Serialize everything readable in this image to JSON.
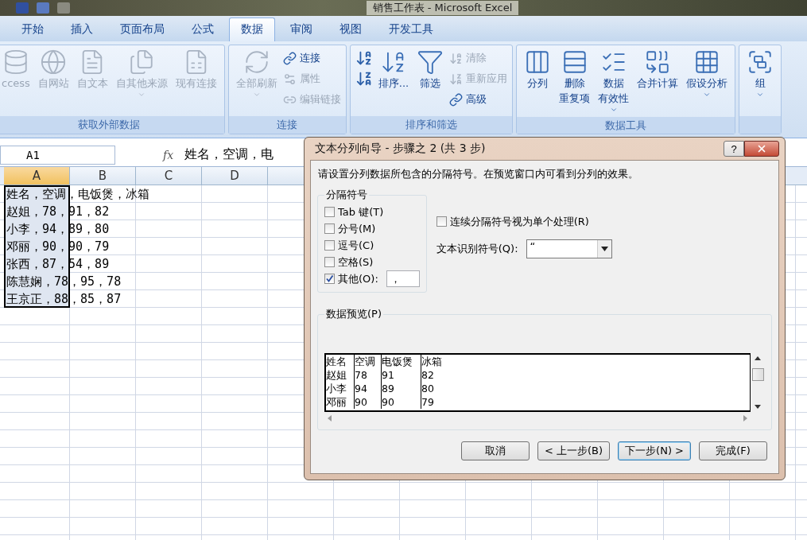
{
  "window": {
    "title": "销售工作表 - Microsoft Excel"
  },
  "ribbon_tabs": [
    {
      "label": "开始",
      "selected": false
    },
    {
      "label": "插入",
      "selected": false
    },
    {
      "label": "页面布局",
      "selected": false
    },
    {
      "label": "公式",
      "selected": false
    },
    {
      "label": "数据",
      "selected": true
    },
    {
      "label": "审阅",
      "selected": false
    },
    {
      "label": "视图",
      "selected": false
    },
    {
      "label": "开发工具",
      "selected": false
    }
  ],
  "ribbon_groups": [
    {
      "label": "获取外部数据",
      "items": [
        {
          "kind": "large",
          "label": "ccess",
          "disabled": true,
          "menu": false
        },
        {
          "kind": "large",
          "label": "自网站",
          "disabled": true,
          "menu": false
        },
        {
          "kind": "large",
          "label": "自文本",
          "disabled": true,
          "menu": false
        },
        {
          "kind": "large",
          "label": "自其他来源",
          "disabled": true,
          "menu": true
        },
        {
          "kind": "large",
          "label": "现有连接",
          "disabled": true,
          "menu": false
        }
      ]
    },
    {
      "label": "连接",
      "items": [
        {
          "kind": "large",
          "label": "全部刷新",
          "disabled": true,
          "menu": true
        },
        {
          "kind": "stack",
          "items": [
            {
              "label": "连接",
              "disabled": false
            },
            {
              "label": "属性",
              "disabled": true
            },
            {
              "label": "编辑链接",
              "disabled": true
            }
          ]
        }
      ]
    },
    {
      "label": "排序和筛选",
      "items": [
        {
          "kind": "stack",
          "items": [
            {
              "disabled": false
            },
            {
              "disabled": false
            }
          ]
        },
        {
          "kind": "large",
          "label": "排序...",
          "disabled": false,
          "menu": false
        },
        {
          "kind": "large",
          "label": "筛选",
          "disabled": false,
          "menu": false
        },
        {
          "kind": "stack",
          "items": [
            {
              "label": "清除",
              "disabled": true
            },
            {
              "label": "重新应用",
              "disabled": true
            },
            {
              "label": "高级",
              "disabled": false
            }
          ]
        }
      ]
    },
    {
      "label": "数据工具",
      "items": [
        {
          "kind": "large",
          "label": "分列",
          "disabled": false,
          "menu": false
        },
        {
          "kind": "large",
          "lines": [
            "删除",
            "重复项"
          ],
          "disabled": false,
          "menu": false
        },
        {
          "kind": "large",
          "lines": [
            "数据",
            "有效性"
          ],
          "disabled": false,
          "menu": true
        },
        {
          "kind": "large",
          "label": "合并计算",
          "disabled": false,
          "menu": false
        },
        {
          "kind": "large",
          "label": "假设分析",
          "disabled": false,
          "menu": true
        }
      ]
    },
    {
      "items": [
        {
          "kind": "large",
          "label": "组",
          "disabled": false,
          "menu": true
        }
      ]
    }
  ],
  "formula_bar": {
    "name_box": "A1",
    "fx": "fx",
    "formula": "姓名，空调，电"
  },
  "columns": [
    {
      "label": "A",
      "selected": true
    },
    {
      "label": "B",
      "selected": false
    },
    {
      "label": "C",
      "selected": false
    },
    {
      "label": "D",
      "selected": false
    }
  ],
  "rows": [
    {
      "text": "姓名，空调，电饭煲，冰箱",
      "selected": true
    },
    {
      "text": "赵姐，78，91，82",
      "selected": true
    },
    {
      "text": "小李，94，89，80",
      "selected": true
    },
    {
      "text": "邓丽，90，90，79",
      "selected": true
    },
    {
      "text": "张西，87，54，89",
      "selected": true
    },
    {
      "text": "陈慧娴，78，95，78",
      "selected": true
    },
    {
      "text": "王京正，88，85，87",
      "selected": true
    }
  ],
  "dialog": {
    "title": "文本分列向导 - 步骤之 2 (共 3 步)",
    "help": "?",
    "instruction": "请设置分列数据所包含的分隔符号。在预览窗口内可看到分列的效果。",
    "delimiters": {
      "label": "分隔符号",
      "options": [
        {
          "label": "Tab 键(T)",
          "checked": false
        },
        {
          "label": "分号(M)",
          "checked": false
        },
        {
          "label": "逗号(C)",
          "checked": false
        },
        {
          "label": "空格(S)",
          "checked": false
        },
        {
          "label": "其他(O):",
          "checked": true,
          "value": "，"
        }
      ]
    },
    "consecutive": {
      "label": "连续分隔符号视为单个处理(R)",
      "checked": false
    },
    "qualifier": {
      "label": "文本识别符号(Q):",
      "value": "“"
    },
    "preview": {
      "label": "数据预览(P)",
      "rows": [
        [
          "姓名",
          "空调",
          "电饭煲",
          "冰箱"
        ],
        [
          "赵姐",
          "78",
          "91",
          "82"
        ],
        [
          "小李",
          "94",
          "89",
          "80"
        ],
        [
          "邓丽",
          "90",
          "90",
          "79"
        ]
      ]
    },
    "buttons": [
      {
        "label": "取消",
        "focused": false
      },
      {
        "label": "< 上一步(B)",
        "focused": false
      },
      {
        "label": "下一步(N) >",
        "focused": true
      },
      {
        "label": "完成(F)",
        "focused": false
      }
    ]
  }
}
